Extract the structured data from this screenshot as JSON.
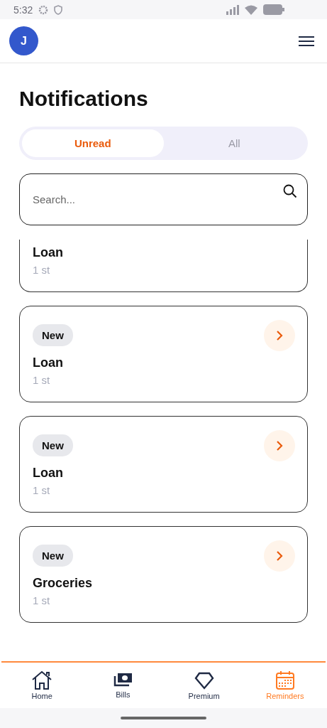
{
  "status_bar": {
    "time": "5:32"
  },
  "header": {
    "avatar": "J"
  },
  "title": "Notifications",
  "tabs": [
    {
      "label": "Unread",
      "selected": true
    },
    {
      "label": "All",
      "selected": false
    }
  ],
  "search": {
    "placeholder": "Search..."
  },
  "notifications": [
    {
      "partial": true,
      "title": "Loan",
      "subtitle": "1 st"
    },
    {
      "partial": false,
      "badge": "New",
      "title": "Loan",
      "subtitle": "1 st"
    },
    {
      "partial": false,
      "badge": "New",
      "title": "Loan",
      "subtitle": "1 st"
    },
    {
      "partial": false,
      "badge": "New",
      "title": "Groceries",
      "subtitle": "1 st"
    }
  ],
  "nav": [
    {
      "kind": "home",
      "label": "Home",
      "selected": false
    },
    {
      "kind": "bills",
      "label": "Bills",
      "selected": false
    },
    {
      "kind": "premium",
      "label": "Premium",
      "selected": false
    },
    {
      "kind": "reminders",
      "label": "Reminders",
      "selected": true
    }
  ]
}
